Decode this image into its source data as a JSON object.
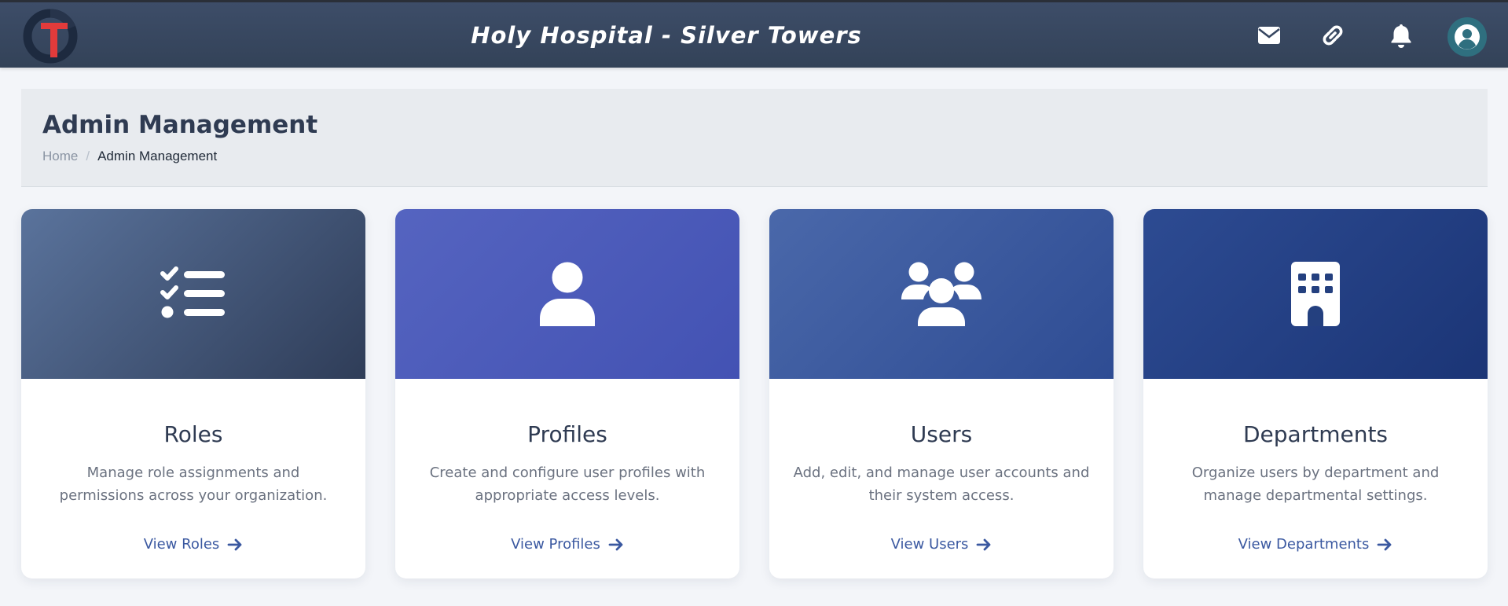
{
  "header": {
    "app_title": "Holy Hospital - Silver Towers",
    "icons": [
      "envelope-icon",
      "link-icon",
      "bell-icon",
      "user-avatar-icon"
    ]
  },
  "page": {
    "title": "Admin Management",
    "breadcrumb": {
      "home": "Home",
      "separator": "/",
      "current": "Admin Management"
    }
  },
  "cards": [
    {
      "icon": "list-check-icon",
      "title": "Roles",
      "description": "Manage role assignments and permissions across your organization.",
      "link": "View Roles"
    },
    {
      "icon": "user-icon",
      "title": "Profiles",
      "description": "Create and configure user profiles with appropriate access levels.",
      "link": "View Profiles"
    },
    {
      "icon": "users-icon",
      "title": "Users",
      "description": "Add, edit, and manage user accounts and their system access.",
      "link": "View Users"
    },
    {
      "icon": "building-icon",
      "title": "Departments",
      "description": "Organize users by department and manage departmental settings.",
      "link": "View Departments"
    }
  ],
  "colors": {
    "topbar": "#364660",
    "roles_banner": "#4e6790",
    "profiles_banner": "#4a5cb8",
    "users_banner": "#3a5da0",
    "departments_banner": "#22408a",
    "link": "#3a58a0"
  }
}
